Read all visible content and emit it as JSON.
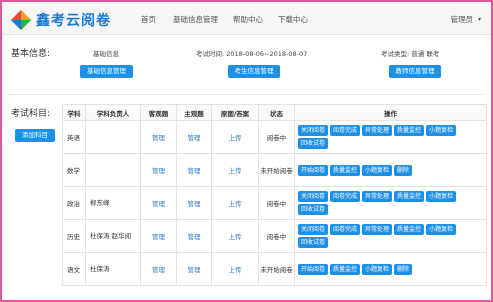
{
  "app": {
    "logo_text": "鑫考云阅卷"
  },
  "nav": {
    "home": "首页",
    "basic_info": "基础信息管理",
    "help": "帮助中心",
    "download": "下载中心"
  },
  "user": {
    "label": "管理员"
  },
  "basic": {
    "section_label": "基本信息:",
    "base_info_label": "基础信息",
    "base_info_button": "基础信息管理",
    "exam_time": "考试时间: 2018-08-06~2018-08-07",
    "examinee_button": "考生信息管理",
    "exam_type": "考试类型: 普通 联考",
    "teacher_button": "教师信息管理"
  },
  "subjects": {
    "section_label": "考试科目:",
    "add_button": "添加科目",
    "columns": [
      "学科",
      "学科负责人",
      "客观题",
      "主观题",
      "原图/答案",
      "状态",
      "操作"
    ],
    "rows": [
      {
        "subject": "英语",
        "responsible": "",
        "objective": "管理",
        "subjective": "管理",
        "upload": "上传",
        "status": "阅卷中",
        "ops": [
          "关闭阅卷",
          "阅卷完成",
          "异常处理",
          "质量监控",
          "小题复检",
          "回收试卷"
        ]
      },
      {
        "subject": "数学",
        "responsible": "",
        "objective": "管理",
        "subjective": "管理",
        "upload": "上传",
        "status": "未开始阅卷",
        "ops": [
          "开始阅卷",
          "质量监控",
          "小题复检",
          "删除"
        ]
      },
      {
        "subject": "政治",
        "responsible": "柳东峰",
        "objective": "管理",
        "subjective": "管理",
        "upload": "上传",
        "status": "阅卷中",
        "ops": [
          "关闭阅卷",
          "阅卷完成",
          "异常处理",
          "质量监控",
          "小题复检",
          "回收试卷"
        ]
      },
      {
        "subject": "历史",
        "responsible": "杜保涛 赵华阅",
        "objective": "管理",
        "subjective": "管理",
        "upload": "上传",
        "status": "阅卷中",
        "ops": [
          "关闭阅卷",
          "阅卷完成",
          "异常处理",
          "质量监控",
          "小题复检",
          "回收试卷"
        ]
      },
      {
        "subject": "语文",
        "responsible": "杜保涛",
        "objective": "管理",
        "subjective": "管理",
        "upload": "上传",
        "status": "未开始阅卷",
        "ops": [
          "开始阅卷",
          "质量监控",
          "小题复检",
          "删除"
        ]
      }
    ]
  },
  "colors": {
    "accent": "#1e90e6",
    "frame": "#e0569a",
    "link": "#2d7cc6"
  }
}
